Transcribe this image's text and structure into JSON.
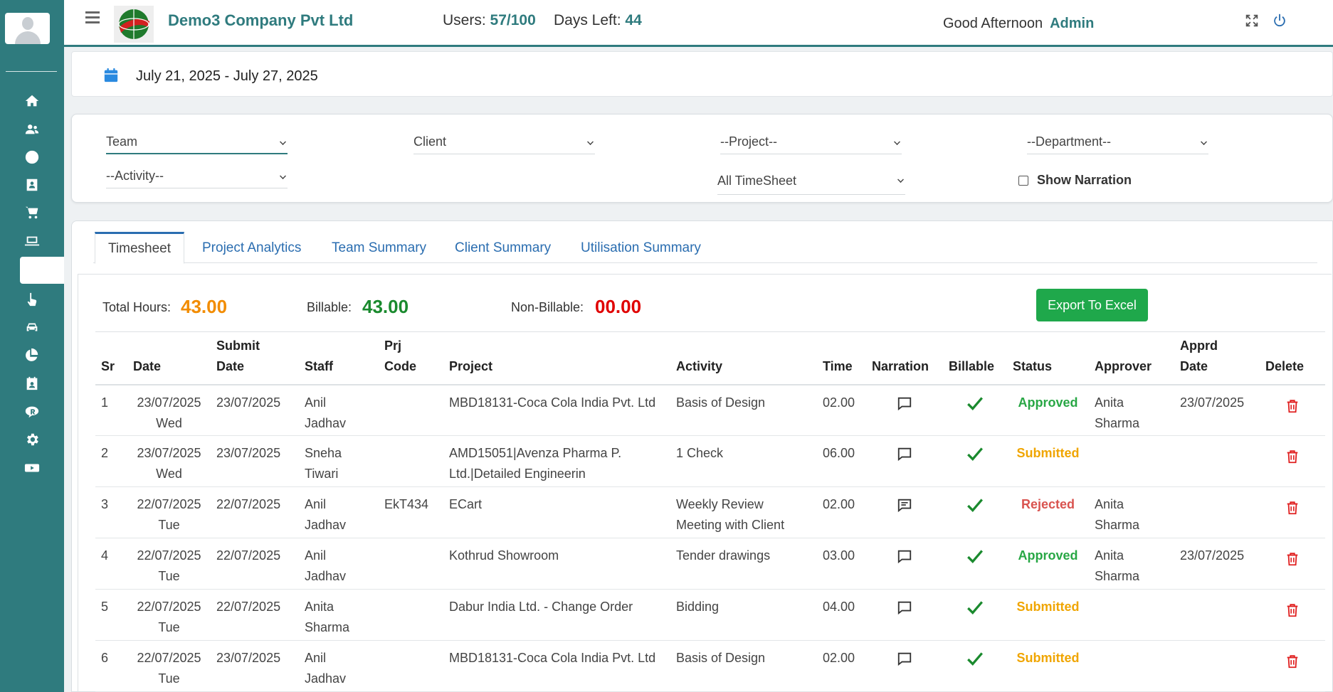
{
  "header": {
    "company": "Demo3 Company Pvt Ltd",
    "users_label": "Users:",
    "users_value": "57/100",
    "days_label": "Days Left:",
    "days_value": "44",
    "greeting": "Good Afternoon",
    "user": "Admin"
  },
  "sidebar": {
    "icons": [
      "home-icon",
      "users-icon",
      "clock-icon",
      "contact-card-icon",
      "cart-icon",
      "laptop-icon",
      "blank-active-item",
      "hand-pointer-icon",
      "car-icon",
      "pie-chart-icon",
      "calendar-user-icon",
      "registered-icon",
      "gear-icon",
      "youtube-icon"
    ]
  },
  "date_range": "July 21, 2025 - July 27, 2025",
  "filters": {
    "team": "Team",
    "client": "Client",
    "project": "--Project--",
    "department": "--Department--",
    "activity": "--Activity--",
    "timesheet": "All TimeSheet",
    "show_narration": "Show Narration"
  },
  "tabs": [
    "Timesheet",
    "Project Analytics",
    "Team Summary",
    "Client Summary",
    "Utilisation Summary"
  ],
  "summary": {
    "total_label": "Total Hours:",
    "total_value": "43.00",
    "billable_label": "Billable:",
    "billable_value": "43.00",
    "nonbillable_label": "Non-Billable:",
    "nonbillable_value": "00.00",
    "export_label": "Export To Excel"
  },
  "table": {
    "headers": {
      "sr": "Sr",
      "date": "Date",
      "submit1": "Submit",
      "submit2": "Date",
      "staff": "Staff",
      "prj1": "Prj",
      "prj2": "Code",
      "project": "Project",
      "activity": "Activity",
      "time": "Time",
      "narration": "Narration",
      "billable": "Billable",
      "status": "Status",
      "approver": "Approver",
      "apprd1": "Apprd",
      "apprd2": "Date",
      "delete": "Delete"
    },
    "rows": [
      {
        "sr": "1",
        "date": "23/07/2025",
        "day": "Wed",
        "submit": "23/07/2025",
        "staff1": "Anil",
        "staff2": "Jadhav",
        "code": "",
        "project1": "MBD18131-Coca Cola India Pvt. Ltd",
        "project2": "",
        "activity1": "Basis of Design",
        "activity2": "",
        "time": "02.00",
        "status": "Approved",
        "appr1": "Anita",
        "appr2": "Sharma",
        "apprd": "23/07/2025"
      },
      {
        "sr": "2",
        "date": "23/07/2025",
        "day": "Wed",
        "submit": "23/07/2025",
        "staff1": "Sneha",
        "staff2": "Tiwari",
        "code": "",
        "project1": "AMD15051|Avenza Pharma P.",
        "project2": "Ltd.|Detailed Engineerin",
        "activity1": "1 Check",
        "activity2": "",
        "time": "06.00",
        "status": "Submitted",
        "appr1": "",
        "appr2": "",
        "apprd": ""
      },
      {
        "sr": "3",
        "date": "22/07/2025",
        "day": "Tue",
        "submit": "22/07/2025",
        "staff1": "Anil",
        "staff2": "Jadhav",
        "code": "EkT434",
        "project1": "ECart",
        "project2": "",
        "activity1": "Weekly Review",
        "activity2": "Meeting with Client",
        "time": "02.00",
        "status": "Rejected",
        "appr1": "Anita",
        "appr2": "Sharma",
        "apprd": ""
      },
      {
        "sr": "4",
        "date": "22/07/2025",
        "day": "Tue",
        "submit": "22/07/2025",
        "staff1": "Anil",
        "staff2": "Jadhav",
        "code": "",
        "project1": "Kothrud Showroom",
        "project2": "",
        "activity1": "Tender drawings",
        "activity2": "",
        "time": "03.00",
        "status": "Approved",
        "appr1": "Anita",
        "appr2": "Sharma",
        "apprd": "23/07/2025"
      },
      {
        "sr": "5",
        "date": "22/07/2025",
        "day": "Tue",
        "submit": "22/07/2025",
        "staff1": "Anita",
        "staff2": "Sharma",
        "code": "",
        "project1": "Dabur India Ltd. - Change Order",
        "project2": "",
        "activity1": "Bidding",
        "activity2": "",
        "time": "04.00",
        "status": "Submitted",
        "appr1": "",
        "appr2": "",
        "apprd": ""
      },
      {
        "sr": "6",
        "date": "22/07/2025",
        "day": "Tue",
        "submit": "23/07/2025",
        "staff1": "Anil",
        "staff2": "Jadhav",
        "code": "",
        "project1": "MBD18131-Coca Cola India Pvt. Ltd",
        "project2": "",
        "activity1": "Basis of Design",
        "activity2": "",
        "time": "02.00",
        "status": "Submitted",
        "appr1": "",
        "appr2": "",
        "apprd": ""
      }
    ]
  },
  "colors": {
    "brand": "#2f7b7e",
    "link": "#2a6db0",
    "total": "#f28c00",
    "billable": "#1a8a2e",
    "nonbillable": "#e00000",
    "export": "#1fa84b"
  }
}
